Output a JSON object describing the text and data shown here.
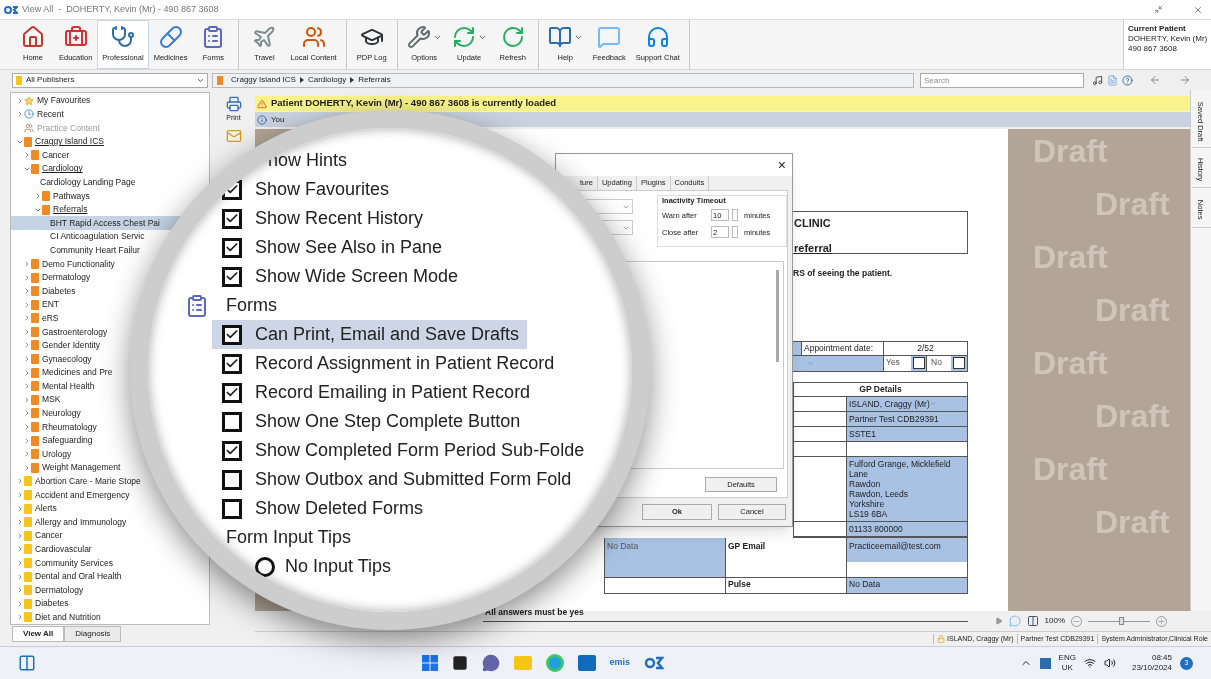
{
  "window": {
    "title": "View All  -  DOHERTY, Kevin (Mr) - 490 867 3608"
  },
  "toolbar_groups": [
    {
      "items": [
        {
          "label": "Home",
          "selected": false,
          "menu": false
        },
        {
          "label": "Education",
          "selected": false,
          "menu": false
        },
        {
          "label": "Professional",
          "selected": true,
          "menu": false
        },
        {
          "label": "Medicines",
          "selected": false,
          "menu": false
        },
        {
          "label": "Forms",
          "selected": false,
          "menu": false
        }
      ]
    },
    {
      "items": [
        {
          "label": "Travel",
          "selected": false,
          "menu": false
        },
        {
          "label": "Local Content",
          "selected": false,
          "menu": false
        }
      ]
    },
    {
      "items": [
        {
          "label": "PDP Log",
          "selected": false,
          "menu": false
        }
      ]
    },
    {
      "items": [
        {
          "label": "Options",
          "selected": false,
          "menu": true
        },
        {
          "label": "Update",
          "selected": false,
          "menu": true
        },
        {
          "label": "Refresh",
          "selected": false,
          "menu": false
        }
      ]
    },
    {
      "items": [
        {
          "label": "Help",
          "selected": false,
          "menu": true
        },
        {
          "label": "Feedback",
          "selected": false,
          "menu": false
        },
        {
          "label": "Support Chat",
          "selected": false,
          "menu": false
        }
      ]
    }
  ],
  "current_patient": {
    "heading": "Current Patient",
    "name": "DOHERTY, Kevin (Mr)",
    "number": "490 867 3608"
  },
  "publisher": {
    "value": "All Publishers"
  },
  "breadcrumb": [
    "Craggy Island ICS",
    "Cardiology",
    "Referrals"
  ],
  "search": {
    "placeholder": "Search"
  },
  "sidebar": {
    "tree": [
      {
        "label": "My Favourites",
        "kind": "favourites",
        "expanded": false,
        "in_path": false,
        "selected": false
      },
      {
        "label": "Recent",
        "kind": "recent",
        "expanded": false,
        "in_path": false,
        "selected": false
      },
      {
        "label": "Practice Content",
        "kind": "practice",
        "in_path": false,
        "selected": false
      },
      {
        "label": "Craggy Island ICS",
        "kind": "folder",
        "expanded": true,
        "in_path": true,
        "selected": false,
        "children": [
          {
            "label": "Cancer",
            "kind": "folder",
            "expanded": false,
            "in_path": false,
            "selected": false
          },
          {
            "label": "Cardiology",
            "kind": "folder",
            "expanded": true,
            "in_path": true,
            "selected": false,
            "children": [
              {
                "label": "Cardiology Landing Page",
                "kind": "page",
                "in_path": false,
                "selected": false
              },
              {
                "label": "Pathways",
                "kind": "folder",
                "expanded": false,
                "in_path": false,
                "selected": false
              },
              {
                "label": "Referrals",
                "kind": "folder",
                "expanded": true,
                "in_path": true,
                "selected": false,
                "children": [
                  {
                    "label": "BHT Rapid Access Chest Pai",
                    "kind": "page",
                    "in_path": false,
                    "selected": true
                  },
                  {
                    "label": "CI Anticoagulation Servic",
                    "kind": "page",
                    "in_path": false,
                    "selected": false
                  },
                  {
                    "label": "Community Heart Failur",
                    "kind": "page",
                    "in_path": false,
                    "selected": false
                  }
                ]
              }
            ]
          },
          {
            "label": "Demo Functionality",
            "kind": "folder",
            "expanded": false,
            "in_path": false,
            "selected": false
          },
          {
            "label": "Dermatology",
            "kind": "folder",
            "expanded": false,
            "in_path": false,
            "selected": false
          },
          {
            "label": "Diabetes",
            "kind": "folder",
            "expanded": false,
            "in_path": false,
            "selected": false
          },
          {
            "label": "ENT",
            "kind": "folder",
            "expanded": false,
            "in_path": false,
            "selected": false
          },
          {
            "label": "eRS",
            "kind": "folder",
            "expanded": false,
            "in_path": false,
            "selected": false
          },
          {
            "label": "Gastroenterology",
            "kind": "folder",
            "expanded": false,
            "in_path": false,
            "selected": false
          },
          {
            "label": "Gender Identity",
            "kind": "folder",
            "expanded": false,
            "in_path": false,
            "selected": false
          },
          {
            "label": "Gynaecology",
            "kind": "folder",
            "expanded": false,
            "in_path": false,
            "selected": false
          },
          {
            "label": "Medicines and Pre",
            "kind": "folder",
            "expanded": false,
            "in_path": false,
            "selected": false
          },
          {
            "label": "Mental Health",
            "kind": "folder",
            "expanded": false,
            "in_path": false,
            "selected": false
          },
          {
            "label": "MSK",
            "kind": "folder",
            "expanded": false,
            "in_path": false,
            "selected": false
          },
          {
            "label": "Neurology",
            "kind": "folder",
            "expanded": false,
            "in_path": false,
            "selected": false
          },
          {
            "label": "Rheumatology",
            "kind": "folder",
            "expanded": false,
            "in_path": false,
            "selected": false
          },
          {
            "label": "Safeguarding",
            "kind": "folder",
            "expanded": false,
            "in_path": false,
            "selected": false
          },
          {
            "label": "Urology",
            "kind": "folder",
            "expanded": false,
            "in_path": false,
            "selected": false
          },
          {
            "label": "Weight Management",
            "kind": "folder",
            "expanded": false,
            "in_path": false,
            "selected": false
          }
        ]
      },
      {
        "label": "Abortion Care - Marie Stope",
        "kind": "category",
        "expanded": false,
        "in_path": false,
        "selected": false
      },
      {
        "label": "Accident and Emergency",
        "kind": "category",
        "expanded": false,
        "in_path": false,
        "selected": false
      },
      {
        "label": "Alerts",
        "kind": "category",
        "expanded": false,
        "in_path": false,
        "selected": false
      },
      {
        "label": "Allergy and Immunology",
        "kind": "category",
        "expanded": false,
        "in_path": false,
        "selected": false
      },
      {
        "label": "Cancer",
        "kind": "category",
        "expanded": false,
        "in_path": false,
        "selected": false
      },
      {
        "label": "Cardiovascular",
        "kind": "category",
        "expanded": false,
        "in_path": false,
        "selected": false
      },
      {
        "label": "Community Services",
        "kind": "category",
        "expanded": false,
        "in_path": false,
        "selected": false
      },
      {
        "label": "Dental and Oral Health",
        "kind": "category",
        "expanded": false,
        "in_path": false,
        "selected": false
      },
      {
        "label": "Dermatology",
        "kind": "category",
        "expanded": false,
        "in_path": false,
        "selected": false
      },
      {
        "label": "Diabetes",
        "kind": "category",
        "expanded": false,
        "in_path": false,
        "selected": false
      },
      {
        "label": "Diet and Nutrition",
        "kind": "category",
        "expanded": false,
        "in_path": false,
        "selected": false
      }
    ],
    "tabs": [
      {
        "label": "View All",
        "selected": true
      },
      {
        "label": "Diagnosis",
        "selected": false
      }
    ]
  },
  "doc_toolbar": {
    "print_label": "Print"
  },
  "banner": {
    "text": "Patient DOHERTY, Kevin (Mr) - 490 867 3608 is currently loaded"
  },
  "info_bar": {
    "text": "You"
  },
  "form": {
    "title": "CLINIC",
    "subtitle": "referral",
    "instruction": "RS of seeing the patient.",
    "appointment_label": "Appointment date:",
    "appointment_value": "2/52",
    "yes_label": "Yes",
    "yes_checked": false,
    "no_label": "No",
    "no_checked": false,
    "gp_heading": "GP Details",
    "gp_rows": [
      {
        "kind": "dropdown",
        "lines": [
          "ISLAND, Craggy (Mr)"
        ]
      },
      {
        "kind": "field",
        "lines": [
          "Partner Test CDB29391"
        ]
      },
      {
        "kind": "field",
        "lines": [
          "SSTE1"
        ]
      },
      {
        "kind": "blank",
        "lines": []
      },
      {
        "kind": "field",
        "lines": [
          "Fulford Grange, Micklefield",
          "Lane",
          "Rawdon",
          "Rawdon, Leeds",
          "Yorkshire",
          "LS19 6BA"
        ]
      },
      {
        "kind": "field",
        "lines": [
          "01133 800000"
        ]
      }
    ],
    "email_row": {
      "left": "No Data",
      "label": "GP Email",
      "value": "Practiceemail@test.com"
    },
    "pulse_row": {
      "label": "Pulse",
      "value": "No Data"
    },
    "answers_note": "All answers must be yes"
  },
  "draft_watermarks": [
    "Draft",
    "Draft",
    "Draft",
    "Draft",
    "Draft",
    "Draft",
    "Draft",
    "Draft"
  ],
  "dialog": {
    "tabs": [
      {
        "label": "ture",
        "selected": false
      },
      {
        "label": "Updating",
        "selected": false
      },
      {
        "label": "Plugins",
        "selected": false
      },
      {
        "label": "Conduits",
        "selected": false
      }
    ],
    "close_glyph": "×",
    "timeout": {
      "title": "Inactivity Timeout",
      "warn_label": "Warn after",
      "warn_value": "10",
      "warn_unit": "minutes",
      "close_label": "Close after",
      "close_value": "2",
      "close_unit": "minutes"
    },
    "defaults_button": "Defaults",
    "ok_button": "Ok",
    "cancel_button": "Cancel"
  },
  "magnifier": {
    "items": [
      {
        "kind": "cut",
        "label": "how Hints"
      },
      {
        "kind": "checkbox",
        "label": "Show Favourites",
        "checked": true,
        "selected": false
      },
      {
        "kind": "checkbox",
        "label": "Show Recent History",
        "checked": true,
        "selected": false
      },
      {
        "kind": "checkbox",
        "label": "Show See Also in Pane",
        "checked": true,
        "selected": false
      },
      {
        "kind": "checkbox",
        "label": "Show Wide Screen Mode",
        "checked": true,
        "selected": false
      },
      {
        "kind": "section",
        "label": "Forms"
      },
      {
        "kind": "checkbox",
        "label": "Can Print, Email and Save Drafts",
        "checked": true,
        "selected": true
      },
      {
        "kind": "checkbox",
        "label": "Record Assignment in Patient Record",
        "checked": true,
        "selected": false
      },
      {
        "kind": "checkbox",
        "label": "Record Emailing in Patient Record",
        "checked": true,
        "selected": false
      },
      {
        "kind": "checkbox",
        "label": "Show One Step Complete Button",
        "checked": false,
        "selected": false
      },
      {
        "kind": "checkbox",
        "label": "Show Completed Form Period Sub-Folde",
        "checked": true,
        "selected": false
      },
      {
        "kind": "checkbox",
        "label": "Show Outbox and Submitted Form Fold",
        "checked": false,
        "selected": false
      },
      {
        "kind": "checkbox",
        "label": "Show Deleted Forms",
        "checked": false,
        "selected": false
      },
      {
        "kind": "heading",
        "label": "Form Input Tips"
      },
      {
        "kind": "radio",
        "label": "No Input Tips",
        "checked": false
      }
    ]
  },
  "side_tabs": [
    {
      "label": "Saved Draft"
    },
    {
      "label": "History"
    },
    {
      "label": "Notes"
    }
  ],
  "zoom": {
    "reading": "100%",
    "level": 0.55
  },
  "status_bar": [
    "ISLAND, Craggy (Mr)",
    "Partner Test CDB29391",
    "System Administrator,Clinical Role"
  ],
  "taskbar": {
    "app_label": "emis",
    "language": "ENG",
    "region": "UK",
    "time": "08:45",
    "date": "23/10/2024",
    "badge": "3"
  }
}
